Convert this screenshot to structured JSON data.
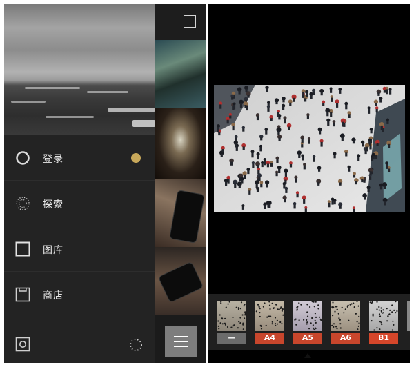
{
  "menu": {
    "items": [
      {
        "id": "login",
        "label": "登录",
        "icon": "circle-icon"
      },
      {
        "id": "explore",
        "label": "探索",
        "icon": "dotted-circle-icon"
      },
      {
        "id": "library",
        "label": "图库",
        "icon": "square-icon"
      },
      {
        "id": "store",
        "label": "商店",
        "icon": "store-box-icon"
      }
    ],
    "bottom_icons": [
      "camera-icon",
      "loading-spinner-icon"
    ],
    "login_dot_color": "#c8a85a"
  },
  "gallery": {
    "select_icon": "select-square-icon",
    "menu_icon": "hamburger-menu-icon"
  },
  "filters": [
    {
      "label": "—",
      "color": "#6b6b6b"
    },
    {
      "label": "A4",
      "color": "#c8462c"
    },
    {
      "label": "A5",
      "color": "#c8462c"
    },
    {
      "label": "A6",
      "color": "#c8462c"
    },
    {
      "label": "B1",
      "color": "#d5462a"
    }
  ],
  "colors": {
    "accent_red": "#c8462c",
    "drawer_bg": "#232323",
    "text": "#e6e6e6"
  }
}
